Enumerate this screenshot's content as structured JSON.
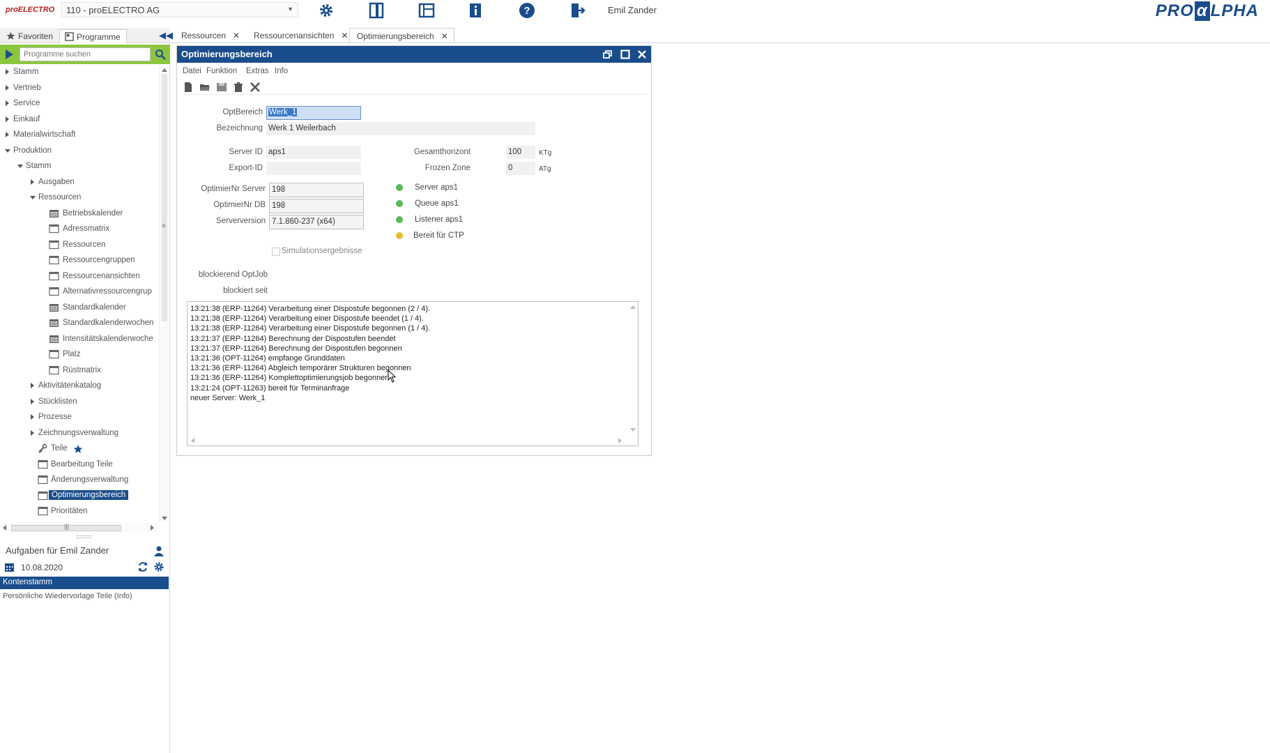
{
  "app": {
    "logo_left": "proELECTRO",
    "company": "110 - proELECTRO AG",
    "user": "Emil Zander",
    "logo_right_pre": "PRO",
    "logo_right_alpha": "α",
    "logo_right_post": "LPHA"
  },
  "toolbar_icons": [
    "gear-icon",
    "panel-icon",
    "layout-icon",
    "info-icon",
    "help-icon",
    "exit-icon"
  ],
  "sidebar": {
    "tabs": [
      {
        "label": "Favoriten",
        "icon": "star-icon"
      },
      {
        "label": "Programme",
        "icon": "programs-icon"
      }
    ],
    "search_placeholder": "Programme suchen",
    "tree": [
      {
        "label": "Stamm",
        "level": 0,
        "expand": "collapsed",
        "icon": ""
      },
      {
        "label": "Vertrieb",
        "level": 0,
        "expand": "collapsed",
        "icon": ""
      },
      {
        "label": "Service",
        "level": 0,
        "expand": "collapsed",
        "icon": ""
      },
      {
        "label": "Einkauf",
        "level": 0,
        "expand": "collapsed",
        "icon": ""
      },
      {
        "label": "Materialwirtschaft",
        "level": 0,
        "expand": "collapsed",
        "icon": ""
      },
      {
        "label": "Produktion",
        "level": 0,
        "expand": "expanded",
        "icon": ""
      },
      {
        "label": "Stamm",
        "level": 1,
        "expand": "expanded",
        "icon": ""
      },
      {
        "label": "Ausgaben",
        "level": 2,
        "expand": "collapsed",
        "icon": ""
      },
      {
        "label": "Ressourcen",
        "level": 2,
        "expand": "expanded",
        "icon": ""
      },
      {
        "label": "Betriebskalender",
        "level": 3,
        "expand": "none",
        "icon": "calendar-icon"
      },
      {
        "label": "Adressmatrix",
        "level": 3,
        "expand": "none",
        "icon": "window-icon"
      },
      {
        "label": "Ressourcen",
        "level": 3,
        "expand": "none",
        "icon": "window-icon"
      },
      {
        "label": "Ressourcengruppen",
        "level": 3,
        "expand": "none",
        "icon": "window-icon"
      },
      {
        "label": "Ressourcenansichten",
        "level": 3,
        "expand": "none",
        "icon": "window-icon"
      },
      {
        "label": "Alternativressourcengrup",
        "level": 3,
        "expand": "none",
        "icon": "window-icon"
      },
      {
        "label": "Standardkalender",
        "level": 3,
        "expand": "none",
        "icon": "calendar-icon"
      },
      {
        "label": "Standardkalenderwochen",
        "level": 3,
        "expand": "none",
        "icon": "calendar-icon"
      },
      {
        "label": "Intensitätskalenderwoche",
        "level": 3,
        "expand": "none",
        "icon": "calendar-icon"
      },
      {
        "label": "Platz",
        "level": 3,
        "expand": "none",
        "icon": "window-icon"
      },
      {
        "label": "Rüstmatrix",
        "level": 3,
        "expand": "none",
        "icon": "window-icon"
      },
      {
        "label": "Aktivitätenkatalog",
        "level": 2,
        "expand": "collapsed",
        "icon": ""
      },
      {
        "label": "Stücklisten",
        "level": 2,
        "expand": "collapsed",
        "icon": ""
      },
      {
        "label": "Prozesse",
        "level": 2,
        "expand": "collapsed",
        "icon": ""
      },
      {
        "label": "Zeichnungsverwaltung",
        "level": 2,
        "expand": "collapsed",
        "icon": ""
      },
      {
        "label": "Teile",
        "level": 2,
        "expand": "none",
        "icon": "parts-icon",
        "favorite": true
      },
      {
        "label": "Bearbeitung Teile",
        "level": 2,
        "expand": "none",
        "icon": "window-icon"
      },
      {
        "label": "Änderungsverwaltung",
        "level": 2,
        "expand": "none",
        "icon": "window-icon"
      },
      {
        "label": "Optimierungsbereich",
        "level": 2,
        "expand": "none",
        "icon": "window-icon",
        "selected": true
      },
      {
        "label": "Prioritäten",
        "level": 2,
        "expand": "none",
        "icon": "window-icon"
      }
    ],
    "tasks": {
      "title": "Aufgaben für Emil Zander",
      "date": "10.08.2020",
      "selected_item": "Kontenstamm",
      "item": "Persönliche Wiedervorlage Teile (Info)"
    }
  },
  "doc_tabs": [
    {
      "label": "Ressourcen"
    },
    {
      "label": "Ressourcenansichten"
    },
    {
      "label": "Optimierungsbereich",
      "active": true
    }
  ],
  "window": {
    "title": "Optimierungsbereich",
    "menu": [
      "Datei",
      "Funktion",
      "Extras",
      "Info"
    ],
    "tools": [
      "new-icon",
      "open-icon",
      "save-icon",
      "delete-icon",
      "cancel-icon"
    ],
    "fields": {
      "optbereich_label": "OptBereich",
      "optbereich_value": "Werk_1",
      "bezeichnung_label": "Bezeichnung",
      "bezeichnung_value": "Werk 1 Weilerbach",
      "server_id_label": "Server ID",
      "server_id_value": "aps1",
      "export_id_label": "Export-ID",
      "export_id_value": "",
      "gesamthorizont_label": "Gesamthorizont",
      "gesamthorizont_value": "100",
      "gesamthorizont_unit": "KTg",
      "frozen_zone_label": "Frozen Zone",
      "frozen_zone_value": "0",
      "frozen_zone_unit": "ATg",
      "optnr_server_label": "OptimierNr Server",
      "optnr_server_value": "198",
      "optnr_db_label": "OptimierNr DB",
      "optnr_db_value": "198",
      "serverversion_label": "Serverversion",
      "serverversion_value": "7.1.860-237 (x64)",
      "simulation_label": "Simulationsergebnisse",
      "blockierend_label": "blockierend OptJob",
      "blockiert_label": "blockiert seit"
    },
    "status": [
      {
        "label": "Server aps1",
        "color": "#5cb85c"
      },
      {
        "label": "Queue aps1",
        "color": "#5cb85c"
      },
      {
        "label": "Listener aps1",
        "color": "#5cb85c"
      },
      {
        "label": "Bereit für CTP",
        "color": "#e0c030"
      }
    ],
    "log": [
      "13:21:38 (ERP-11264) Verarbeitung einer Dispostufe begonnen (2 / 4).",
      "13:21:38 (ERP-11264) Verarbeitung einer Dispostufe beendet (1 / 4).",
      "13:21:38 (ERP-11264) Verarbeitung einer Dispostufe begonnen (1 / 4).",
      "13:21:37 (ERP-11264) Berechnung der Dispostufen beendet",
      "13:21:37 (ERP-11264) Berechnung der Dispostufen begonnen",
      "13:21:36 (OPT-11264) empfange Grunddaten",
      "13:21:36 (ERP-11264) Abgleich temporärer Strukturen begonnen",
      "13:21:36 (ERP-11264) Komplettoptimierungsjob begonnen",
      "13:21:24 (OPT-11263) bereit für Terminanfrage",
      "neuer Server: Werk_1"
    ]
  },
  "colors": {
    "accent": "#1a4d8c",
    "search_bar": "#8cc63f",
    "status_green": "#5cb85c",
    "status_yellow": "#e0c030"
  }
}
